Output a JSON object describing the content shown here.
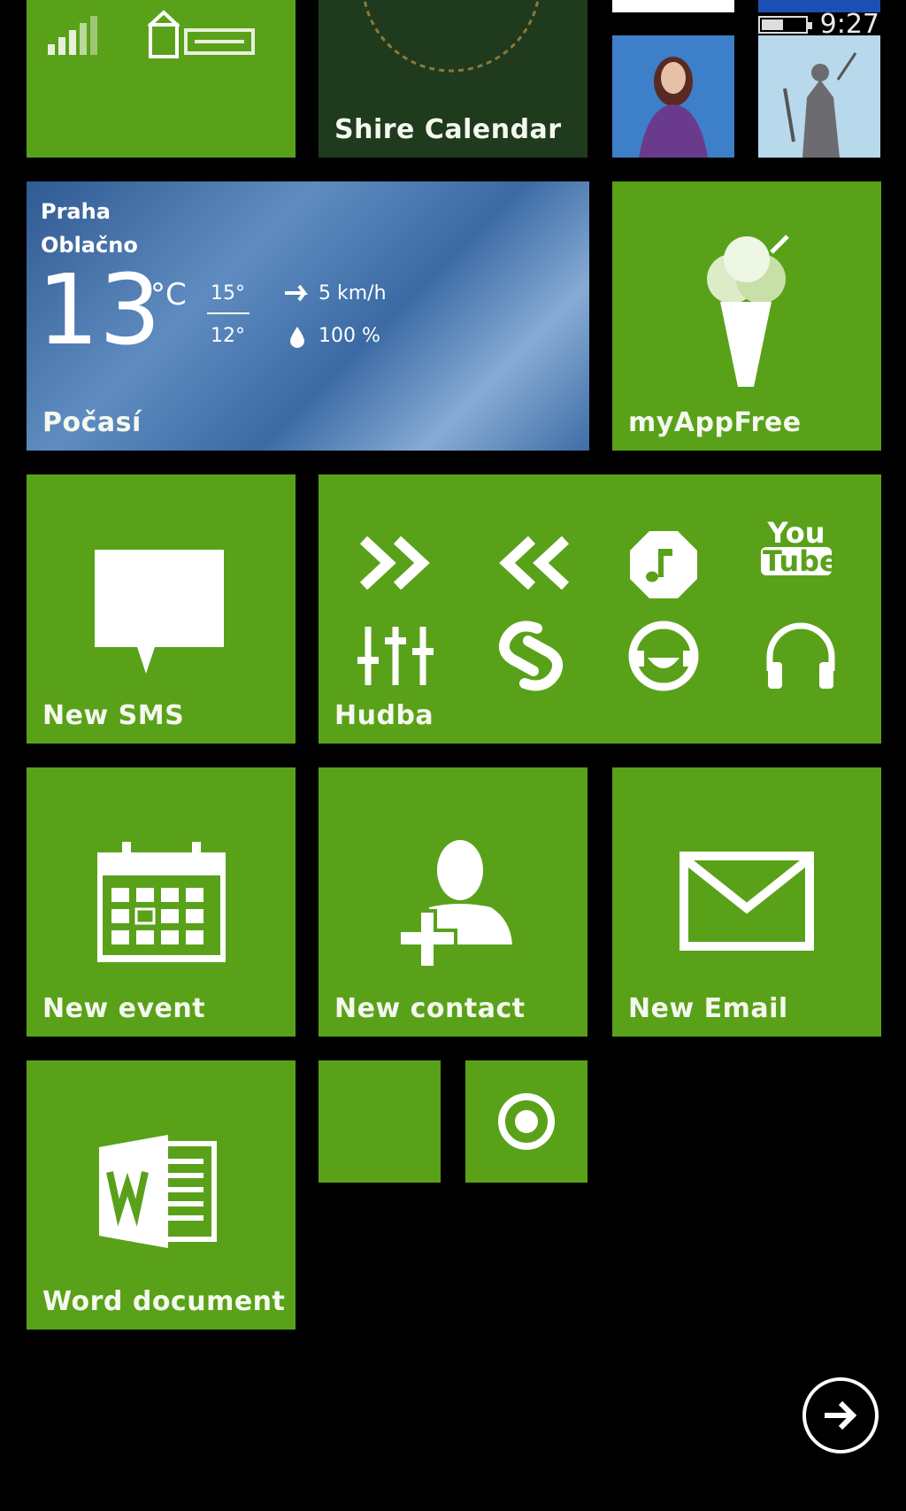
{
  "status_bar": {
    "time": "9:27",
    "battery_level": 0.5
  },
  "tiles": {
    "signal_tile": {
      "icon": "signal-bars-icon"
    },
    "shire_calendar": {
      "label": "Shire Calendar"
    },
    "people_photo": {
      "icon": "person-photo"
    },
    "justice_photo": {
      "icon": "statue-photo"
    },
    "weather": {
      "city": "Praha",
      "condition": "Oblačno",
      "temp": "13",
      "unit": "°C",
      "high": "15°",
      "low": "12°",
      "wind": "5 km/h",
      "humidity": "100 %",
      "label": "Počasí"
    },
    "myappfree": {
      "label": "myAppFree",
      "icon": "ice-cream-icon"
    },
    "new_sms": {
      "label": "New SMS",
      "icon": "speech-bubble-icon"
    },
    "hudba": {
      "label": "Hudba",
      "icons": [
        "fast-forward-icon",
        "rewind-icon",
        "music-note-icon",
        "youtube-icon",
        "equalizer-icon",
        "shazam-icon",
        "smiley-headphones-icon",
        "headphones-icon"
      ],
      "youtube_top": "You",
      "youtube_bottom": "Tube"
    },
    "new_event": {
      "label": "New event",
      "icon": "calendar-icon"
    },
    "new_contact": {
      "label": "New contact",
      "icon": "add-contact-icon"
    },
    "new_email": {
      "label": "New Email",
      "icon": "envelope-icon"
    },
    "word_document": {
      "label": "Word document",
      "icon": "word-icon"
    },
    "small_blank": {
      "icon": ""
    },
    "small_record": {
      "icon": "record-icon"
    }
  },
  "navigation": {
    "next_icon": "arrow-right-icon"
  },
  "colors": {
    "accent": "#5aa11a",
    "background": "#000000"
  }
}
